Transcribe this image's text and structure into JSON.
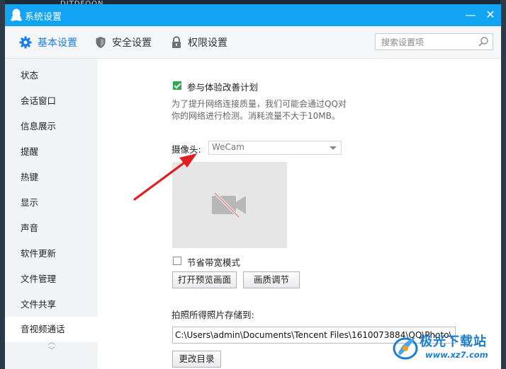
{
  "window": {
    "title": "系统设置",
    "minimize_glyph": "—",
    "close_glyph": "✕"
  },
  "tabs": [
    {
      "label": "基本设置",
      "icon": "gear-icon",
      "active": true
    },
    {
      "label": "安全设置",
      "icon": "shield-icon",
      "active": false
    },
    {
      "label": "权限设置",
      "icon": "lock-icon",
      "active": false
    }
  ],
  "search": {
    "placeholder": "搜索设置项",
    "value": ""
  },
  "sidebar": {
    "items": [
      {
        "label": "状态"
      },
      {
        "label": "会话窗口"
      },
      {
        "label": "信息展示"
      },
      {
        "label": "提醒"
      },
      {
        "label": "热键"
      },
      {
        "label": "显示"
      },
      {
        "label": "声音"
      },
      {
        "label": "软件更新"
      },
      {
        "label": "文件管理"
      },
      {
        "label": "文件共享"
      },
      {
        "label": "音视频通话",
        "active": true
      }
    ],
    "scroll_up": "︿",
    "scroll_down": "﹀"
  },
  "content": {
    "experience": {
      "label": "参与体验改善计划",
      "checked": true,
      "description_line1": "为了提升网络连接质量，我们可能会通过QQ对",
      "description_line2": "你的网络进行检测。消耗流量不大于10MB。"
    },
    "camera": {
      "label": "摄像头:",
      "selected": "WeCam"
    },
    "bandwidth": {
      "label": "节省带宽模式",
      "checked": false
    },
    "buttons": {
      "open_preview": "打开预览画面",
      "quality": "画质调节",
      "change_dir": "更改目录"
    },
    "photo_save": {
      "label": "拍照所得照片存储到:",
      "path": "C:\\Users\\admin\\Documents\\Tencent Files\\1610073884\\QQ\\Photo\\"
    }
  },
  "background": {
    "top_text": "DITDFOON"
  },
  "watermark": {
    "main": "极光下载站",
    "sub": "www.xz7.com"
  },
  "colors": {
    "titlebar": "#12a4f2",
    "active_tab": "#1a7ee6",
    "checkbox_checked": "#2fa84f",
    "annotation_arrow": "#e02020"
  }
}
